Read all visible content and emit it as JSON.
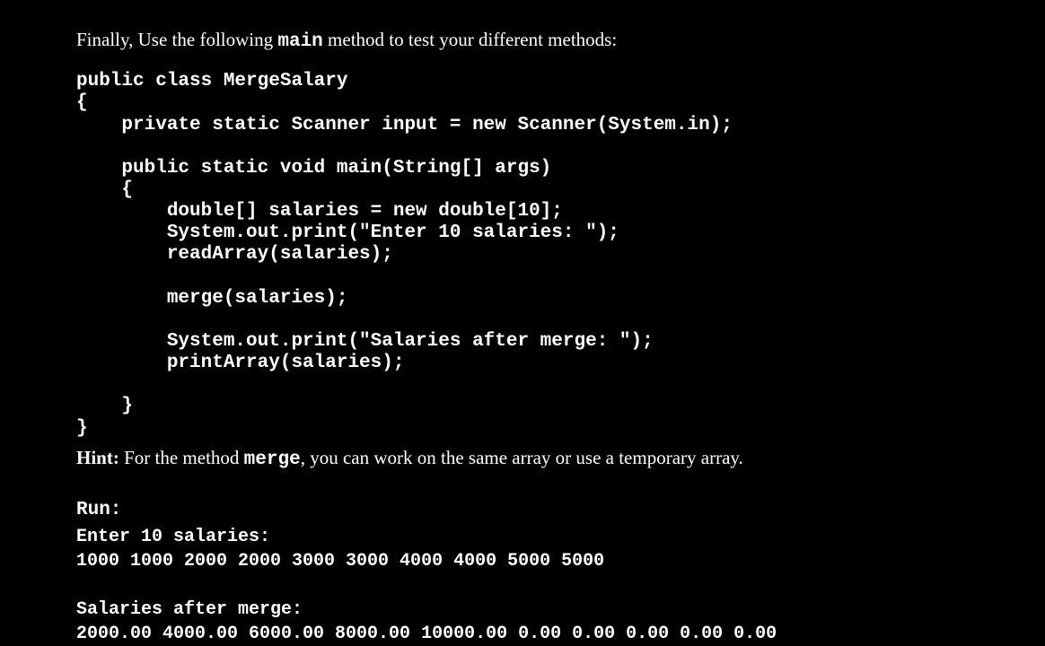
{
  "intro": {
    "prefix": "Finally, Use the following ",
    "code_word": "main",
    "suffix": " method to test your different methods:"
  },
  "code": "public class MergeSalary\n{\n    private static Scanner input = new Scanner(System.in);\n\n    public static void main(String[] args)\n    {\n        double[] salaries = new double[10];\n        System.out.print(\"Enter 10 salaries: \");\n        readArray(salaries);\n\n        merge(salaries);\n\n        System.out.print(\"Salaries after merge: \");\n        printArray(salaries);\n\n    }\n}",
  "hint": {
    "label": "Hint:",
    "prefix": " For the method ",
    "code_word": "merge",
    "suffix": ", you can work on the same array or use a temporary array."
  },
  "run": {
    "label": "Run:",
    "output": "Enter 10 salaries:\n1000 1000 2000 2000 3000 3000 4000 4000 5000 5000\n\nSalaries after merge:\n2000.00 4000.00 6000.00 8000.00 10000.00 0.00 0.00 0.00 0.00 0.00"
  }
}
